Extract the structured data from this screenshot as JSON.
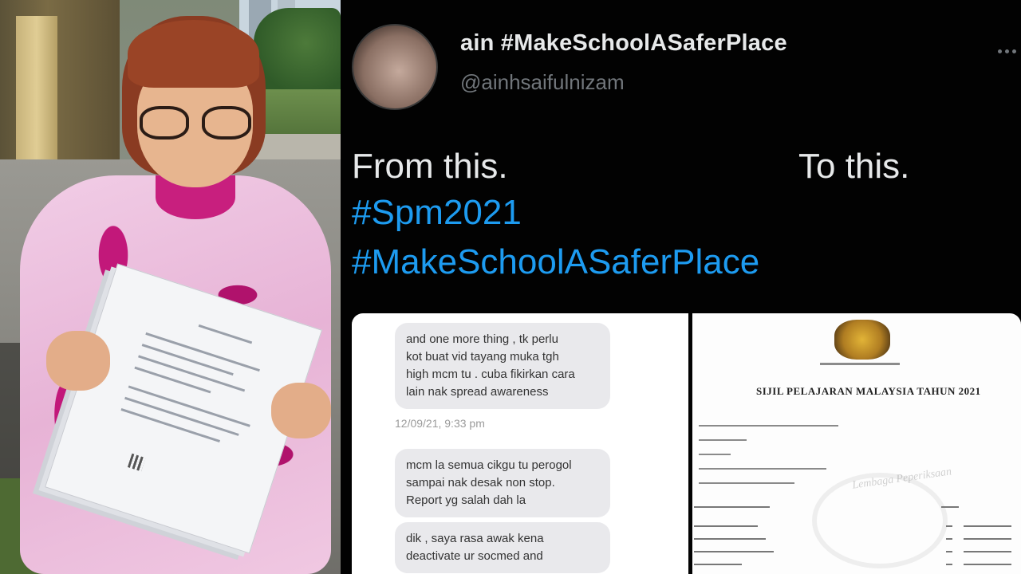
{
  "tweet": {
    "display_name": "ain #MakeSchoolASaferPlace",
    "handle": "@ainhsaifulnizam",
    "text_from": "From this.",
    "text_to": "To this.",
    "hashtags": [
      "#Spm2021",
      "#MakeSchoolASaferPlace"
    ]
  },
  "chat_screenshot": {
    "bubble_1": [
      "and one more thing , tk perlu",
      "kot buat vid tayang muka tgh",
      "high mcm tu . cuba fikirkan cara",
      "lain nak spread awareness"
    ],
    "timestamp": "12/09/21, 9:33 pm",
    "bubble_2": [
      "mcm la semua cikgu tu perogol",
      "sampai nak desak non stop.",
      "Report yg salah dah la"
    ],
    "bubble_3": [
      "dik , saya rasa awak kena",
      "deactivate ur socmed and"
    ]
  },
  "certificate": {
    "title": "SIJIL PELAJARAN MALAYSIA TAHUN 2021",
    "watermark": "Lembaga Peperiksaan"
  },
  "colors": {
    "background": "#000000",
    "name_text": "#e7e9ea",
    "handle_text": "#71767b",
    "hashtag": "#1d9bf0",
    "dress_pink": "#c2187a"
  },
  "icons": [
    "more-options-icon",
    "avatar"
  ]
}
